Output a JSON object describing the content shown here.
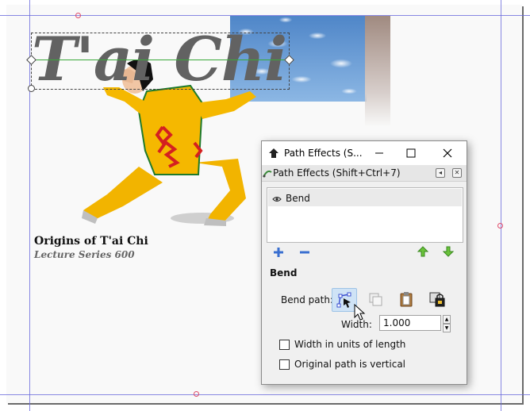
{
  "canvas": {
    "artwork_title": "T'ai Chi",
    "caption_title": "Origins of T'ai Chi",
    "caption_subtitle": "Lecture Series 600"
  },
  "dialog": {
    "window_title": "Path Effects  (S...",
    "dock_title": "Path Effects  (Shift+Ctrl+7)",
    "effects_list": [
      {
        "label": "Bend",
        "visible": true
      }
    ],
    "section_title": "Bend",
    "bend_path_label": "Bend path:",
    "width_label": "Width:",
    "width_value": "1.000",
    "checkbox_width_units": {
      "label": "Width in units of length",
      "checked": false
    },
    "checkbox_vertical": {
      "label": "Original path is vertical",
      "checked": false
    }
  },
  "icons": {
    "add": "plus-icon",
    "remove": "minus-icon",
    "up": "arrow-up-icon",
    "down": "arrow-down-icon",
    "edit_path": "node-edit-icon",
    "copy_path": "copy-icon",
    "paste_path": "paste-icon",
    "link_path": "link-lock-icon"
  },
  "colors": {
    "guide": "#6a6adc",
    "selection_line": "#3aa83a",
    "shirt": "#f5b800",
    "active_button": "#cfe3f6"
  }
}
